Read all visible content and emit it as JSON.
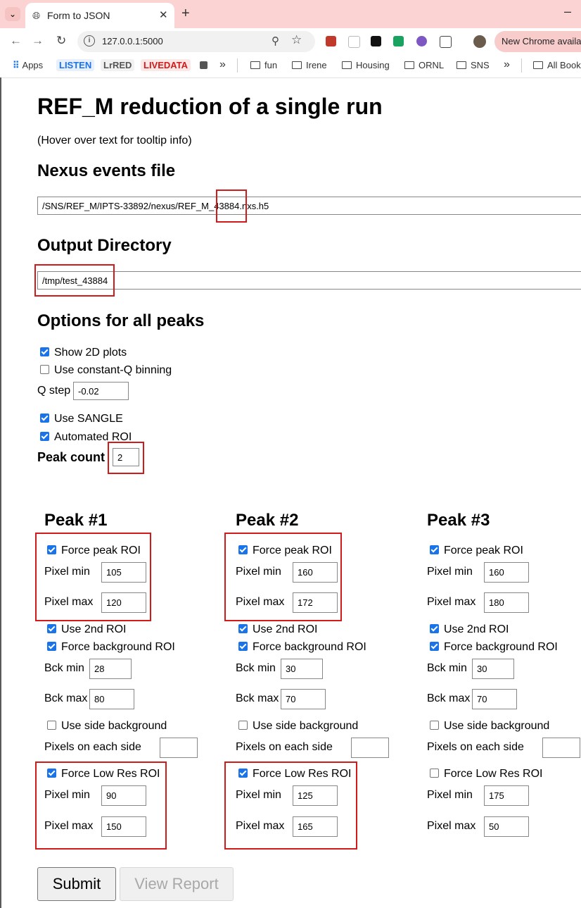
{
  "browser": {
    "tab_title": "Form to JSON",
    "new_tab": "+",
    "close": "✕",
    "minimize": "–",
    "url": "127.0.0.1:5000",
    "promo": "New Chrome availa",
    "bookmarks": {
      "apps": "Apps",
      "listen": "LISTEN",
      "lrred": "LrRED",
      "livedata": "LIVEDATA",
      "more1": "»",
      "fun": "fun",
      "irene": "Irene",
      "housing": "Housing",
      "ornl": "ORNL",
      "sns": "SNS",
      "more2": "»",
      "all": "All Book"
    }
  },
  "page": {
    "title": "REF_M reduction of a single run",
    "hint": "(Hover over text for tooltip info)",
    "nexus": {
      "heading": "Nexus events file",
      "value": "/SNS/REF_M/IPTS-33892/nexus/REF_M_43884.nxs.h5"
    },
    "output": {
      "heading": "Output Directory",
      "value": "/tmp/test_43884"
    },
    "options": {
      "heading": "Options for all peaks",
      "show_2d": {
        "label": "Show 2D plots",
        "checked": true
      },
      "const_q": {
        "label": "Use constant-Q binning",
        "checked": false
      },
      "q_step": {
        "label": "Q step",
        "value": "-0.02"
      },
      "sangle": {
        "label": "Use SANGLE",
        "checked": true
      },
      "auto_roi": {
        "label": "Automated ROI",
        "checked": true
      },
      "peak_count": {
        "label": "Peak count",
        "value": "2"
      }
    },
    "peaks": [
      {
        "title": "Peak #1",
        "force_peak": {
          "label": "Force peak ROI",
          "checked": true
        },
        "pixel_min": {
          "label": "Pixel min",
          "value": "105"
        },
        "pixel_max": {
          "label": "Pixel max",
          "value": "120"
        },
        "use_2nd": {
          "label": "Use 2nd ROI",
          "checked": true
        },
        "force_bck": {
          "label": "Force background ROI",
          "checked": true
        },
        "bck_min": {
          "label": "Bck min",
          "value": "28"
        },
        "bck_max": {
          "label": "Bck max",
          "value": "80"
        },
        "side_bck": {
          "label": "Use side background",
          "checked": false
        },
        "side_pixels": {
          "label": "Pixels on each side",
          "value": ""
        },
        "force_lowres": {
          "label": "Force Low Res ROI",
          "checked": true
        },
        "lowres_min": {
          "label": "Pixel min",
          "value": "90"
        },
        "lowres_max": {
          "label": "Pixel max",
          "value": "150"
        }
      },
      {
        "title": "Peak #2",
        "force_peak": {
          "label": "Force peak ROI",
          "checked": true
        },
        "pixel_min": {
          "label": "Pixel min",
          "value": "160"
        },
        "pixel_max": {
          "label": "Pixel max",
          "value": "172"
        },
        "use_2nd": {
          "label": "Use 2nd ROI",
          "checked": true
        },
        "force_bck": {
          "label": "Force background ROI",
          "checked": true
        },
        "bck_min": {
          "label": "Bck min",
          "value": "30"
        },
        "bck_max": {
          "label": "Bck max",
          "value": "70"
        },
        "side_bck": {
          "label": "Use side background",
          "checked": false
        },
        "side_pixels": {
          "label": "Pixels on each side",
          "value": ""
        },
        "force_lowres": {
          "label": "Force Low Res ROI",
          "checked": true
        },
        "lowres_min": {
          "label": "Pixel min",
          "value": "125"
        },
        "lowres_max": {
          "label": "Pixel max",
          "value": "165"
        }
      },
      {
        "title": "Peak #3",
        "force_peak": {
          "label": "Force peak ROI",
          "checked": true
        },
        "pixel_min": {
          "label": "Pixel min",
          "value": "160"
        },
        "pixel_max": {
          "label": "Pixel max",
          "value": "180"
        },
        "use_2nd": {
          "label": "Use 2nd ROI",
          "checked": true
        },
        "force_bck": {
          "label": "Force background ROI",
          "checked": true
        },
        "bck_min": {
          "label": "Bck min",
          "value": "30"
        },
        "bck_max": {
          "label": "Bck max",
          "value": "70"
        },
        "side_bck": {
          "label": "Use side background",
          "checked": false
        },
        "side_pixels": {
          "label": "Pixels on each side",
          "value": ""
        },
        "force_lowres": {
          "label": "Force Low Res ROI",
          "checked": false
        },
        "lowres_min": {
          "label": "Pixel min",
          "value": "175"
        },
        "lowres_max": {
          "label": "Pixel max",
          "value": "50"
        }
      }
    ],
    "submit": "Submit",
    "view_report": "View Report"
  },
  "colors": {
    "highlight": "#d11a1a",
    "checkbox": "#1a73e8",
    "tabbar": "#fbd3d3"
  }
}
